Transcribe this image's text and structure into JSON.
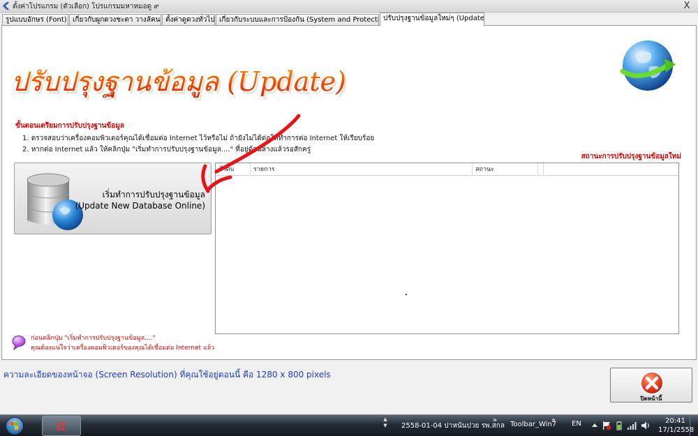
{
  "window": {
    "title": "ตั้งค่าโปรแกรม (ตัวเลือก) โปรแกรมมหาหมอดู ๙",
    "close_glyph": "X"
  },
  "tabs": [
    {
      "label": "รูปแบบอักษร (Font)",
      "active": false
    },
    {
      "label": "เกี่ยวกับผูกดวงชะตา วางลัคนา",
      "active": false
    },
    {
      "label": "ตั้งค่าดูดวงทั่วไป",
      "active": false
    },
    {
      "label": "เกี่ยวกับระบบและการป้องกัน (System and Protection)",
      "active": false
    },
    {
      "label": "ปรับปรุงฐานข้อมูลใหม่ๆ (Update)",
      "active": true
    }
  ],
  "page": {
    "heading": "ปรับปรุงฐานข้อมูล (Update)",
    "steps_title": "ขั้นตอนเตรียมการปรับปรุงฐานข้อมูล",
    "step1": "1. ตรวจสอบว่าเครื่องคอมพิวเตอร์คุณได้เชื่อมต่อ Internet ไว้หรือไม่ ถ้ายังไม่ได้ต่อให้ทำการต่อ Internet ให้เรียบร้อย",
    "step2": "2. หากต่อ Internet แล้ว ให้คลิกปุ่ม \"เริ่มทำการปรับปรุงฐานข้อมูล....\" ที่อยู่ด้านล่างแล้วรอสักครู่",
    "status_caption": "สถานะการปรับปรุงฐานข้อมูลใหม่",
    "update_button": {
      "line1": "เริ่มทำการปรับปรุงฐานข้อมูล",
      "line2": "(Update New Database Online)"
    },
    "status_list": {
      "columns": [
        "ลำดับ",
        "รายการ",
        "สถานะ",
        ""
      ],
      "rows": []
    },
    "note1": "ก่อนคลิกปุ่ม \"เริ่มทำการปรับปรุงฐานข้อมูล....\"",
    "note2": "คุณต้องแน่ใจว่าเครื่องคอมพิวเตอร์ของคุณได้เชื่อมต่อ Internet แล้ว",
    "resolution_text": "ความละเอียดของหน้าจอ (Screen Resolution) ที่คุณใช้อยู่ตอนนี้ คือ 1280 x 800 pixels",
    "close_button_label": "ปิดหน้านี้"
  },
  "taskbar": {
    "app_glyph": "α",
    "toolbar1_text": "2558-01-04 ปาหนันปวย รพ.สกล",
    "chevron": "»",
    "toolbar2_text": "Toolbar_Win7",
    "language": "EN",
    "clock_time": "20:41",
    "clock_date": "17/1/2558"
  },
  "colors": {
    "heading_orange": "#ff4a00",
    "warning_red": "#e00000",
    "resolution_blue": "#1a3fc0",
    "arrow_red": "#e8121a"
  }
}
